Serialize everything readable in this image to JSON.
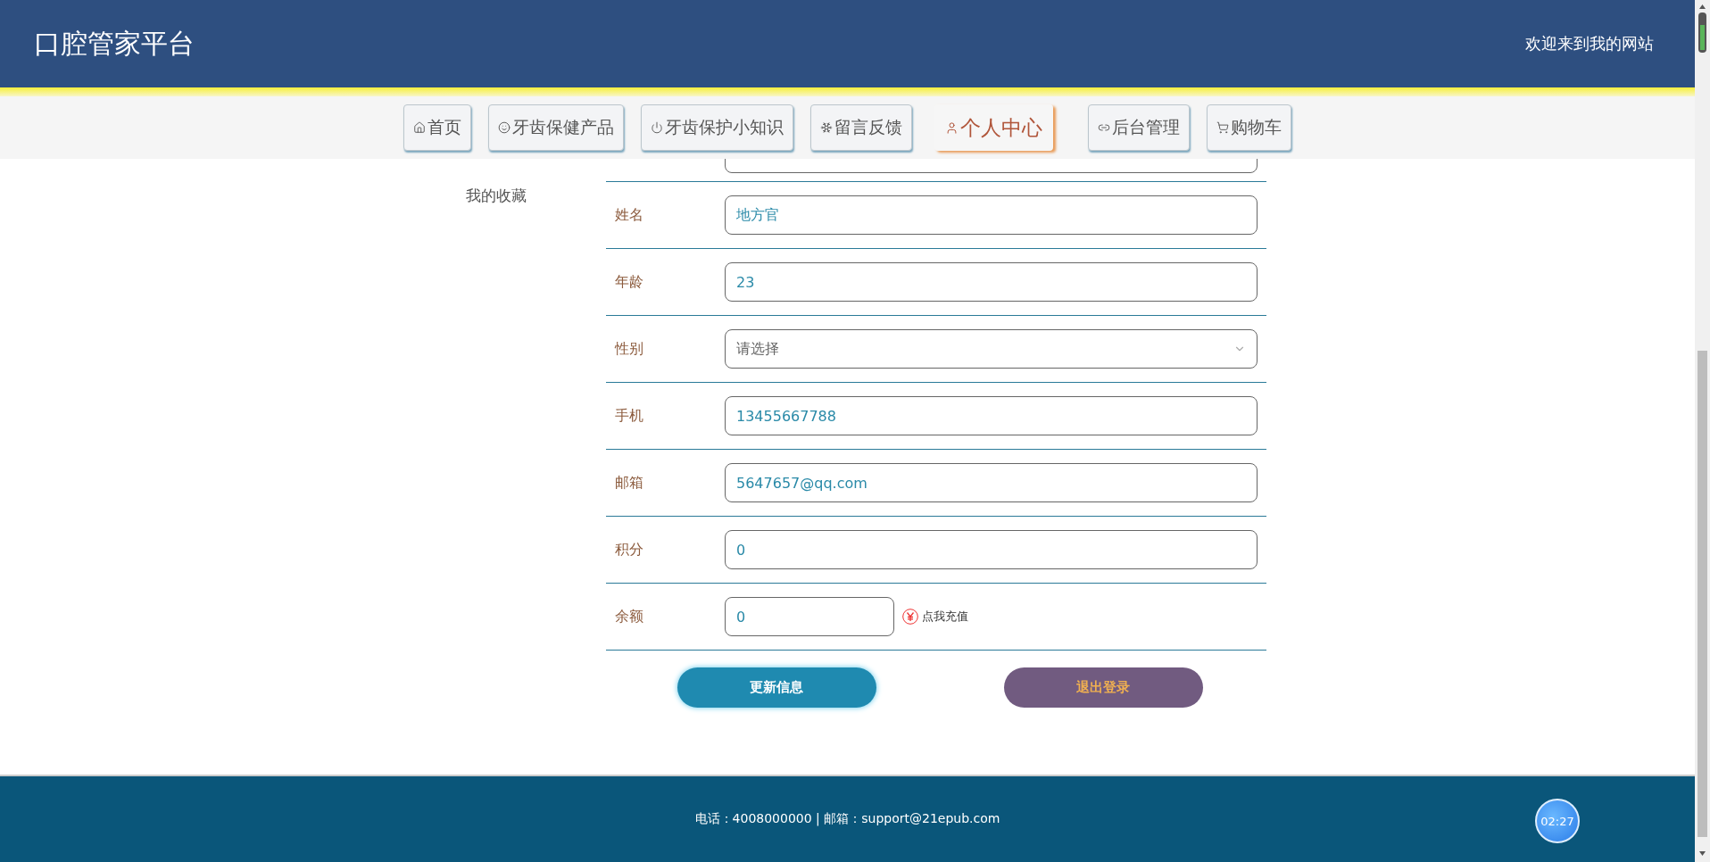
{
  "header": {
    "title": "口腔管家平台",
    "welcome": "欢迎来到我的网站"
  },
  "nav": [
    {
      "label": "首页",
      "selected": false
    },
    {
      "label": "牙齿保健产品",
      "selected": false
    },
    {
      "label": "牙齿保护小知识",
      "selected": false
    },
    {
      "label": "留言反馈",
      "selected": false
    },
    {
      "label": "个人中心",
      "selected": true
    },
    {
      "label": "后台管理",
      "selected": false
    },
    {
      "label": "购物车",
      "selected": false
    }
  ],
  "sidebar": {
    "items": [
      "我的收藏"
    ]
  },
  "form": {
    "fields": [
      {
        "label": "姓名",
        "kind": "text",
        "value": "地方官"
      },
      {
        "label": "年龄",
        "kind": "text",
        "value": "23"
      },
      {
        "label": "性别",
        "kind": "select",
        "placeholder": "请选择"
      },
      {
        "label": "手机",
        "kind": "text",
        "value": "13455667788"
      },
      {
        "label": "邮箱",
        "kind": "text",
        "value": "5647657@qq.com"
      },
      {
        "label": "积分",
        "kind": "text",
        "value": "0"
      },
      {
        "label": "余额",
        "kind": "balance",
        "value": "0",
        "link": "点我充值"
      }
    ],
    "buttons": [
      {
        "label": "更新信息",
        "kind": "primary"
      },
      {
        "label": "退出登录",
        "kind": "secondary"
      }
    ]
  },
  "footer": {
    "text": "电话：4008000000 | 邮箱：support@21epub.com",
    "timer": "02:27"
  }
}
